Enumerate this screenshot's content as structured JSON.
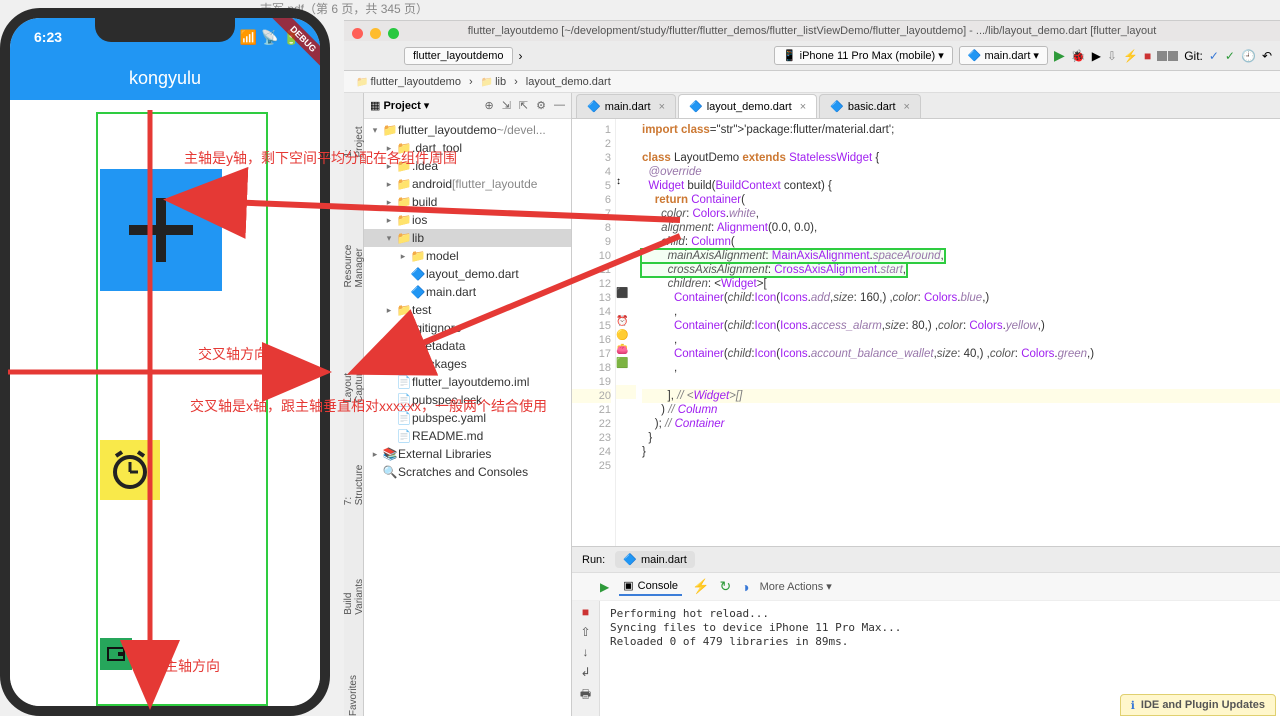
{
  "remnant_pdf": "志军.pdf（第 6 页，共 345 页）",
  "phone": {
    "time": "6:23",
    "app_title": "kongyulu",
    "debug": "DEBUG"
  },
  "annotations": {
    "main_axis_desc": "主轴是y轴，剩下空间平均分配在各组件周围",
    "cross_axis_label": "交叉轴方向",
    "cross_axis_desc": "交叉轴是x轴，跟主轴垂直相对xxxxxx，一般两个结合使用",
    "main_axis_label": "主轴方向"
  },
  "ide": {
    "title": "flutter_layoutdemo [~/development/study/flutter/flutter_demos/flutter_listViewDemo/flutter_layoutdemo] - .../lib/layout_demo.dart [flutter_layout",
    "toolbar": {
      "project": "flutter_layoutdemo",
      "device": "iPhone 11 Pro Max (mobile)",
      "config": "main.dart",
      "git": "Git:"
    },
    "breadcrumb": [
      "flutter_layoutdemo",
      "lib",
      "layout_demo.dart"
    ],
    "project_panel": {
      "header": "Project",
      "tree": [
        {
          "depth": 0,
          "arrow": "▾",
          "icon": "📁",
          "name": "flutter_layoutdemo",
          "suffix": " ~/devel..."
        },
        {
          "depth": 1,
          "arrow": "▸",
          "icon": "📁",
          "name": ".dart_tool"
        },
        {
          "depth": 1,
          "arrow": "▸",
          "icon": "📁",
          "name": ".idea"
        },
        {
          "depth": 1,
          "arrow": "▸",
          "icon": "📁",
          "name": "android",
          "suffix": " [flutter_layoutde"
        },
        {
          "depth": 1,
          "arrow": "▸",
          "icon": "📁",
          "name": "build"
        },
        {
          "depth": 1,
          "arrow": "▸",
          "icon": "📁",
          "name": "ios"
        },
        {
          "depth": 1,
          "arrow": "▾",
          "icon": "📁",
          "name": "lib",
          "selected": true
        },
        {
          "depth": 2,
          "arrow": "▸",
          "icon": "📁",
          "name": "model"
        },
        {
          "depth": 2,
          "arrow": " ",
          "icon": "🔷",
          "name": "layout_demo.dart"
        },
        {
          "depth": 2,
          "arrow": " ",
          "icon": "🔷",
          "name": "main.dart"
        },
        {
          "depth": 1,
          "arrow": "▸",
          "icon": "📁",
          "name": "test"
        },
        {
          "depth": 1,
          "arrow": " ",
          "icon": "📄",
          "name": ".gitignore"
        },
        {
          "depth": 1,
          "arrow": " ",
          "icon": "📄",
          "name": ".metadata"
        },
        {
          "depth": 1,
          "arrow": " ",
          "icon": "📄",
          "name": ".packages"
        },
        {
          "depth": 1,
          "arrow": " ",
          "icon": "📄",
          "name": "flutter_layoutdemo.iml"
        },
        {
          "depth": 1,
          "arrow": " ",
          "icon": "📄",
          "name": "pubspec.lock"
        },
        {
          "depth": 1,
          "arrow": " ",
          "icon": "📄",
          "name": "pubspec.yaml"
        },
        {
          "depth": 1,
          "arrow": " ",
          "icon": "📄",
          "name": "README.md"
        },
        {
          "depth": 0,
          "arrow": "▸",
          "icon": "📚",
          "name": "External Libraries"
        },
        {
          "depth": 0,
          "arrow": " ",
          "icon": "🔍",
          "name": "Scratches and Consoles"
        }
      ]
    },
    "side_tabs": [
      "1: Project",
      "Resource Manager",
      "Layout Capture",
      "7: Structure",
      "Build Variants",
      "Favorites"
    ],
    "editor_tabs": [
      {
        "label": "main.dart",
        "active": false
      },
      {
        "label": "layout_demo.dart",
        "active": true
      },
      {
        "label": "basic.dart",
        "active": false
      }
    ],
    "gutter_icons": {
      "5": "↕",
      "13": "⬛",
      "15": "⏰🟡",
      "17": "👛🟩"
    },
    "code_lines": [
      "import 'package:flutter/material.dart';",
      "",
      "class LayoutDemo extends StatelessWidget {",
      "  @override",
      "  Widget build(BuildContext context) {",
      "    return Container(",
      "      color: Colors.white,",
      "      alignment: Alignment(0.0, 0.0),",
      "      child: Column(",
      "        mainAxisAlignment: MainAxisAlignment.spaceAround,",
      "        crossAxisAlignment: CrossAxisAlignment.start,",
      "        children: <Widget>[",
      "          Container(child:Icon(Icons.add,size: 160,) ,color: Colors.blue,)",
      "          ,",
      "          Container(child:Icon(Icons.access_alarm,size: 80,) ,color: Colors.yellow,)",
      "          ,",
      "          Container(child:Icon(Icons.account_balance_wallet,size: 40,) ,color: Colors.green,)",
      "          ,",
      "",
      "        ], // <Widget>[]",
      "      ) // Column",
      "    ); // Container",
      "  }",
      "}",
      ""
    ],
    "highlight_line": 20,
    "run": {
      "label": "Run:",
      "config": "main.dart",
      "tab": "Console",
      "more": "More Actions",
      "output": "Performing hot reload...\nSyncing files to device iPhone 11 Pro Max...\nReloaded 0 of 479 libraries in 89ms.\n"
    },
    "footer_notice": "IDE and Plugin Updates"
  }
}
